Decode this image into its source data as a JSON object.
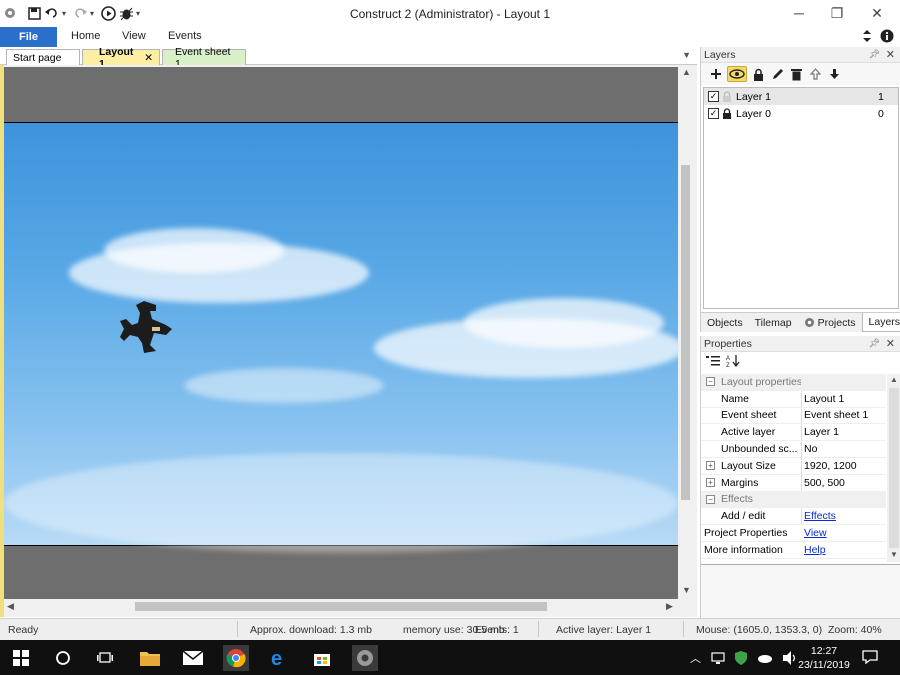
{
  "window": {
    "title": "Construct 2 (Administrator) - Layout 1",
    "minimize": "─",
    "restore": "❐",
    "close": "✕"
  },
  "ribbon": {
    "file": "File",
    "tabs": [
      "Home",
      "View",
      "Events"
    ]
  },
  "doc_tabs": [
    {
      "label": "Start page",
      "active": false
    },
    {
      "label": "Layout 1",
      "active": true
    },
    {
      "label": "Event sheet 1",
      "active": false
    }
  ],
  "layers": {
    "title": "Layers",
    "items": [
      {
        "name": "Layer 1",
        "number": "1",
        "checked": true,
        "locked": false,
        "selected": true
      },
      {
        "name": "Layer 0",
        "number": "0",
        "checked": true,
        "locked": true,
        "selected": false
      }
    ],
    "tabs": [
      "Objects",
      "Tilemap",
      "Projects",
      "Layers"
    ]
  },
  "properties": {
    "title": "Properties",
    "categories": {
      "layout": "Layout properties",
      "effects": "Effects"
    },
    "rows": {
      "name": {
        "name": "Name",
        "value": "Layout 1"
      },
      "event_sheet": {
        "name": "Event sheet",
        "value": "Event sheet 1"
      },
      "active_layer": {
        "name": "Active layer",
        "value": "Layer 1"
      },
      "unbounded": {
        "name": "Unbounded sc...",
        "value": "No"
      },
      "layout_size": {
        "name": "Layout Size",
        "value": "1920, 1200"
      },
      "margins": {
        "name": "Margins",
        "value": "500, 500"
      },
      "add_edit": {
        "name": "Add / edit",
        "value": "Effects"
      },
      "project_props": {
        "name": "Project Properties",
        "value": "View"
      },
      "more_info": {
        "name": "More information",
        "value": "Help"
      }
    }
  },
  "status": {
    "ready": "Ready",
    "download": "Approx. download: 1.3 mb",
    "memory": "memory use: 30.5 mb",
    "events": "Events: 1",
    "active_layer": "Active layer: Layer 1",
    "mouse": "Mouse: (1605.0, 1353.3, 0)",
    "zoom": "Zoom: 40%"
  },
  "taskbar": {
    "time": "12:27",
    "date": "23/11/2019"
  },
  "colors": {
    "file_tab": "#2a6fc9",
    "layout_tab": "#fcefa3",
    "events_tab": "#d9efc7",
    "sky_top": "#3e93dc",
    "sky_bottom": "#b7daf6"
  }
}
